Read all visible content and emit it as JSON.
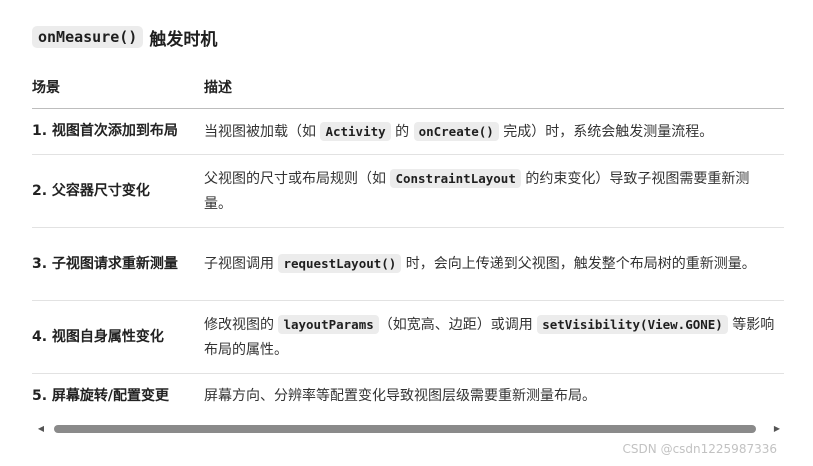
{
  "heading": {
    "code": "onMeasure()",
    "text": "触发时机"
  },
  "table": {
    "headers": [
      "场景",
      "描述"
    ],
    "rows": [
      {
        "scene": "1. 视图首次添加到布局",
        "d": [
          "当视图被加载（如 ",
          "Activity",
          " 的 ",
          "onCreate()",
          " 完成）时，系统会触发测量流程。"
        ]
      },
      {
        "scene": "2. 父容器尺寸变化",
        "d": [
          "父视图的尺寸或布局规则（如 ",
          "ConstraintLayout",
          " 的约束变化）导致子视图需要重新测量。"
        ]
      },
      {
        "scene": "3. 子视图请求重新测量",
        "d": [
          "子视图调用 ",
          "requestLayout()",
          " 时，会向上传递到父视图，触发整个布局树的重新测量。"
        ]
      },
      {
        "scene": "4. 视图自身属性变化",
        "d": [
          "修改视图的 ",
          "layoutParams",
          "（如宽高、边距）或调用 ",
          "setVisibility(View.GONE)",
          " 等影响布局的属性。"
        ]
      },
      {
        "scene": "5. 屏幕旋转/配置变更",
        "d": [
          "屏幕方向、分辨率等配置变化导致视图层级需要重新测量布局。"
        ]
      }
    ]
  },
  "scrollbar": {
    "left_arrow": "◀",
    "right_arrow": "▶"
  },
  "watermark": "CSDN @csdn1225987336"
}
